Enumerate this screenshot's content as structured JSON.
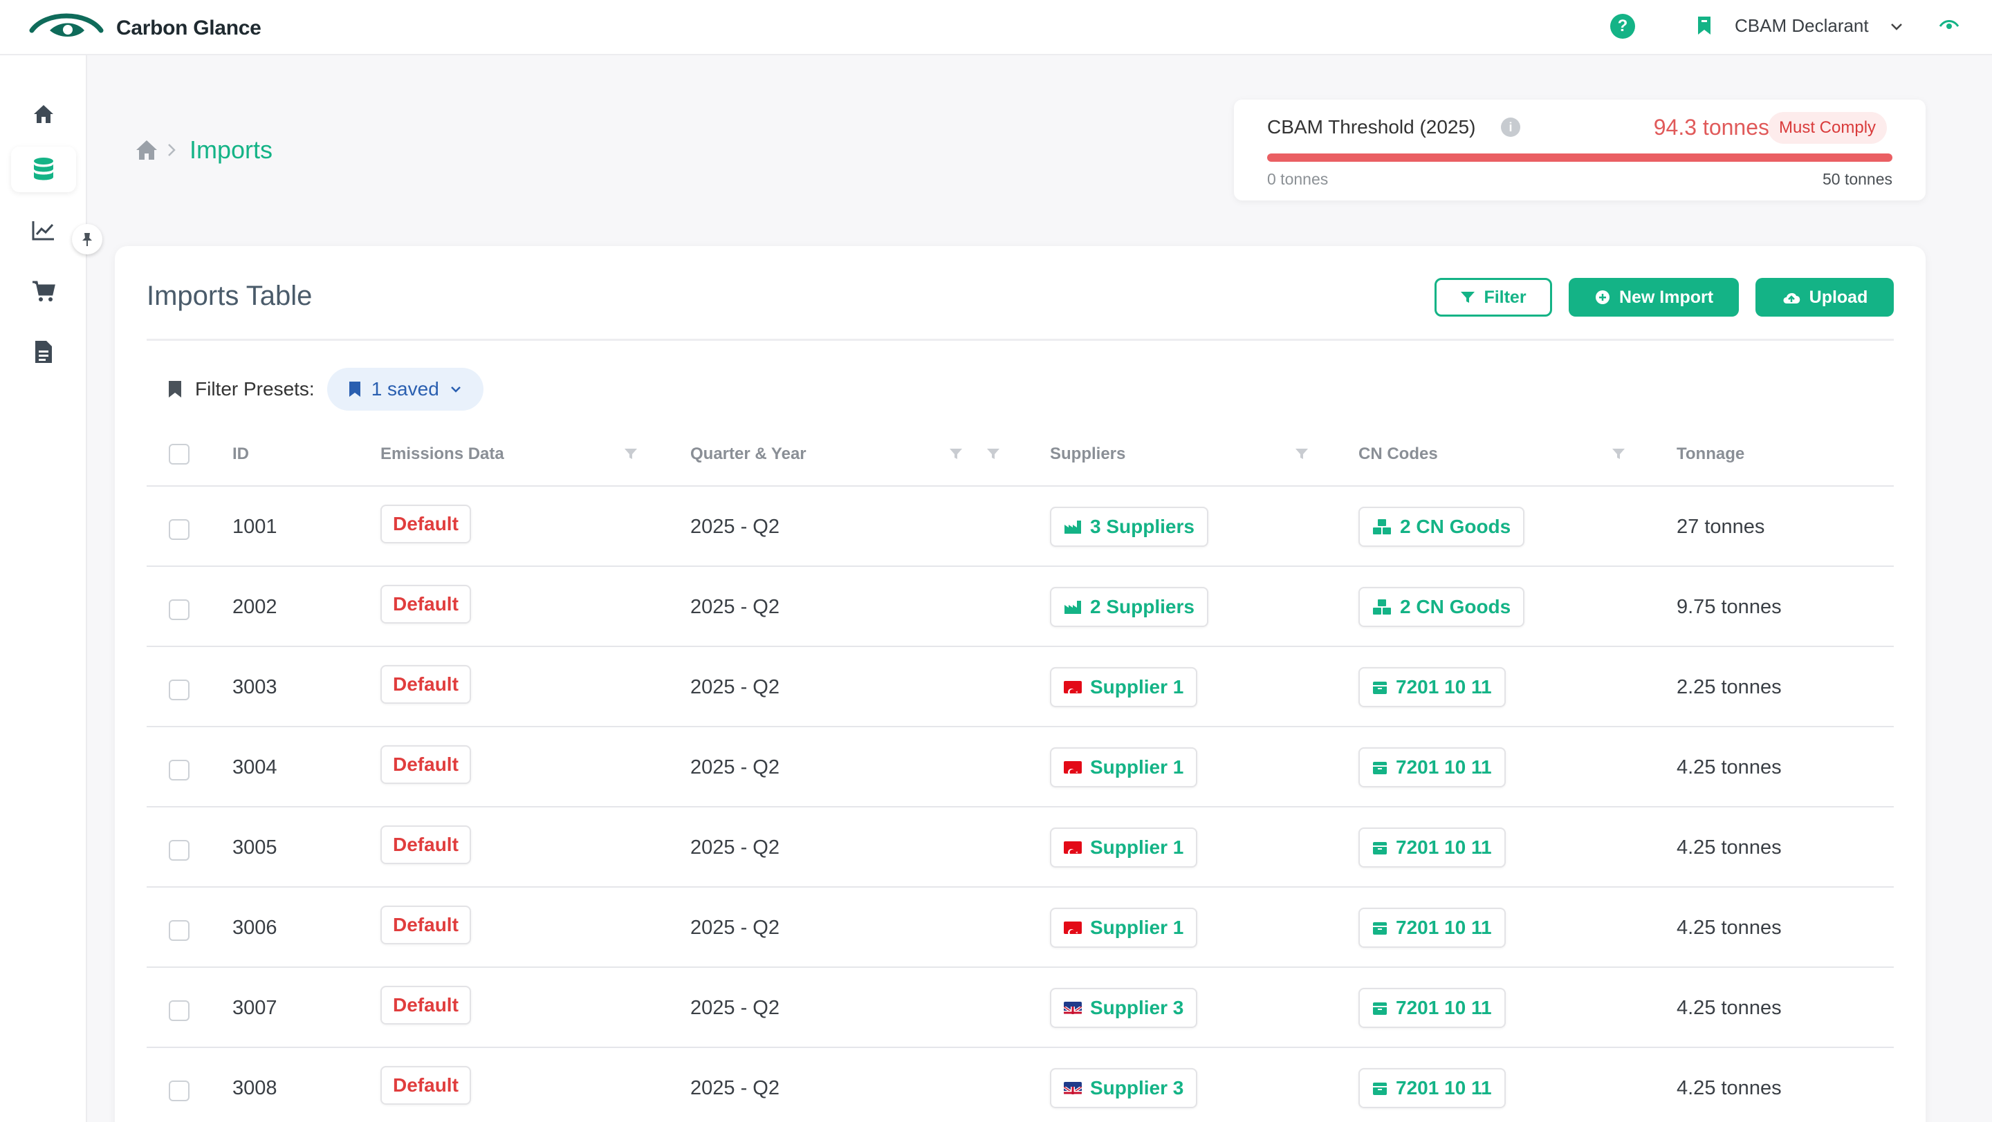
{
  "app": {
    "brand": "Carbon Glance",
    "user_role": "CBAM Declarant",
    "help_label": "?"
  },
  "breadcrumb": {
    "current": "Imports"
  },
  "threshold": {
    "title": "CBAM Threshold (2025)",
    "value": "94.3 tonnes",
    "status": "Must Comply",
    "min_label": "0 tonnes",
    "max_label": "50 tonnes",
    "progress_percent": 100,
    "bar_color": "#ea5f63"
  },
  "main": {
    "title": "Imports Table",
    "buttons": {
      "filter": "Filter",
      "new_import": "New Import",
      "upload": "Upload"
    },
    "presets": {
      "label": "Filter Presets:",
      "value": "1 saved"
    }
  },
  "table": {
    "columns": [
      "ID",
      "Emissions Data",
      "Quarter & Year",
      "Suppliers",
      "CN Codes",
      "Tonnage"
    ],
    "rows": [
      {
        "id": "1001",
        "emissions": "Default",
        "quarter": "2025 - Q2",
        "supplier": "3 Suppliers",
        "supplier_icon": "factory-icon",
        "cn": "2 CN Goods",
        "cn_icon": "boxes-icon",
        "tonnage": "27 tonnes"
      },
      {
        "id": "2002",
        "emissions": "Default",
        "quarter": "2025 - Q2",
        "supplier": "2 Suppliers",
        "supplier_icon": "factory-icon",
        "cn": "2 CN Goods",
        "cn_icon": "boxes-icon",
        "tonnage": "9.75 tonnes"
      },
      {
        "id": "3003",
        "emissions": "Default",
        "quarter": "2025 - Q2",
        "supplier": "Supplier 1",
        "supplier_icon": "turkey-flag-icon",
        "cn": "7201 10 11",
        "cn_icon": "box-icon",
        "tonnage": "2.25 tonnes"
      },
      {
        "id": "3004",
        "emissions": "Default",
        "quarter": "2025 - Q2",
        "supplier": "Supplier 1",
        "supplier_icon": "turkey-flag-icon",
        "cn": "7201 10 11",
        "cn_icon": "box-icon",
        "tonnage": "4.25 tonnes"
      },
      {
        "id": "3005",
        "emissions": "Default",
        "quarter": "2025 - Q2",
        "supplier": "Supplier 1",
        "supplier_icon": "turkey-flag-icon",
        "cn": "7201 10 11",
        "cn_icon": "box-icon",
        "tonnage": "4.25 tonnes"
      },
      {
        "id": "3006",
        "emissions": "Default",
        "quarter": "2025 - Q2",
        "supplier": "Supplier 1",
        "supplier_icon": "turkey-flag-icon",
        "cn": "7201 10 11",
        "cn_icon": "box-icon",
        "tonnage": "4.25 tonnes"
      },
      {
        "id": "3007",
        "emissions": "Default",
        "quarter": "2025 - Q2",
        "supplier": "Supplier 3",
        "supplier_icon": "uk-flag-icon",
        "cn": "7201 10 11",
        "cn_icon": "box-icon",
        "tonnage": "4.25 tonnes"
      },
      {
        "id": "3008",
        "emissions": "Default",
        "quarter": "2025 - Q2",
        "supplier": "Supplier 3",
        "supplier_icon": "uk-flag-icon",
        "cn": "7201 10 11",
        "cn_icon": "box-icon",
        "tonnage": "4.25 tonnes"
      }
    ]
  },
  "sidebar": {
    "items": [
      {
        "icon": "home-icon"
      },
      {
        "icon": "database-icon",
        "active": true
      },
      {
        "icon": "chart-line-icon"
      },
      {
        "icon": "cart-icon"
      },
      {
        "icon": "document-icon"
      }
    ]
  },
  "colors": {
    "accent": "#14b386",
    "danger": "#e03d3d",
    "preset_blue": "#2a5fb0"
  }
}
